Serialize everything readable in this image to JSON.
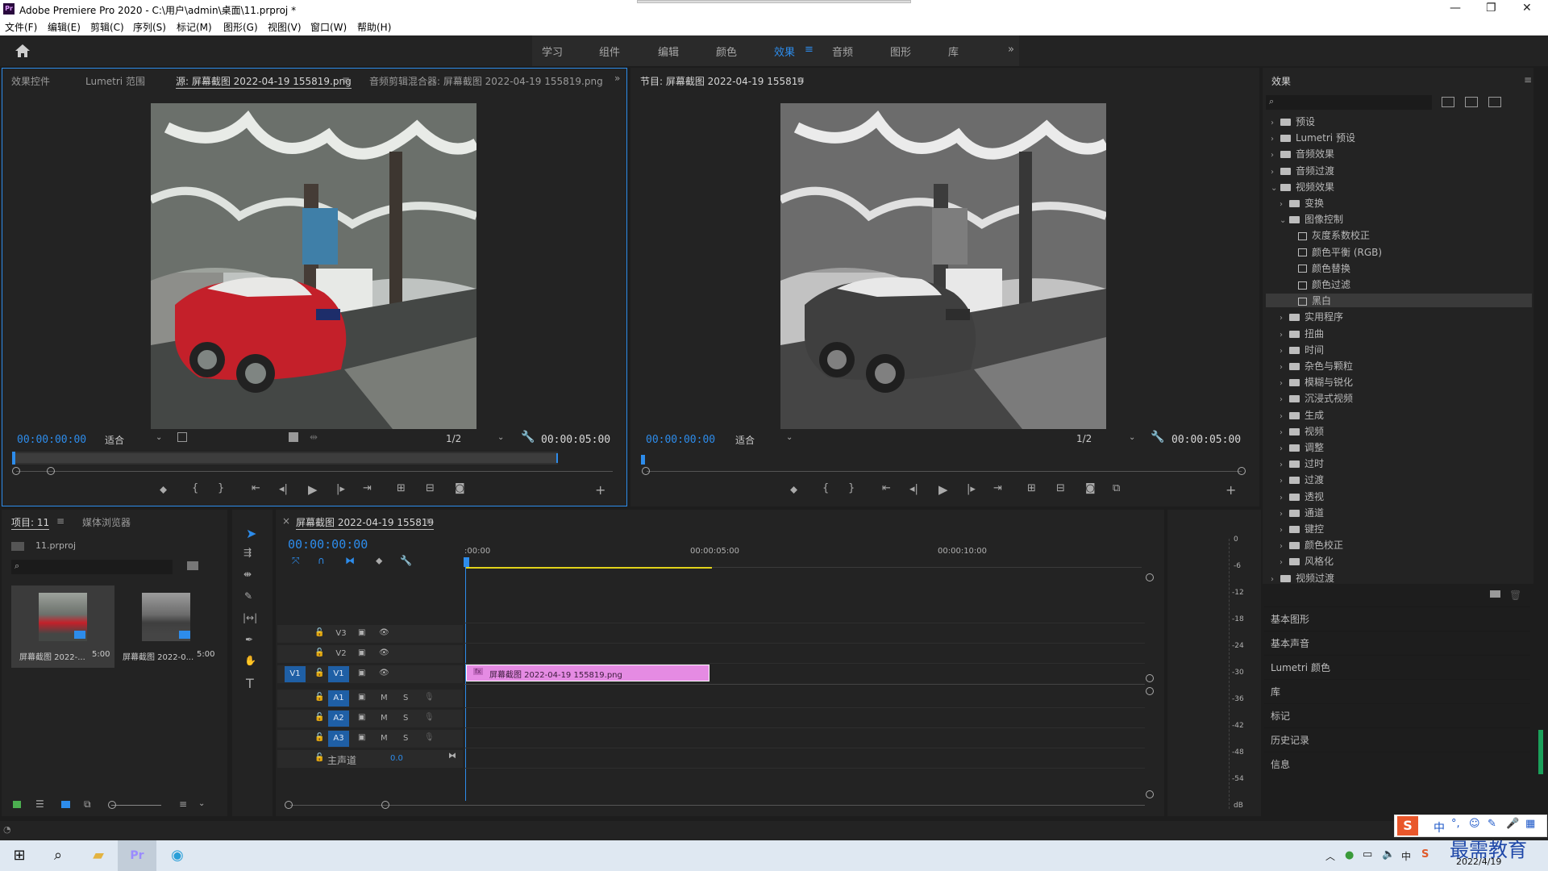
{
  "window": {
    "title": "Adobe Premiere Pro 2020 - C:\\用户\\admin\\桌面\\11.prproj *",
    "app_badge": "Pr",
    "min": "—",
    "max": "❐",
    "close": "✕"
  },
  "menu": [
    "文件(F)",
    "编辑(E)",
    "剪辑(C)",
    "序列(S)",
    "标记(M)",
    "图形(G)",
    "视图(V)",
    "窗口(W)",
    "帮助(H)"
  ],
  "workspaces": {
    "tabs": [
      "学习",
      "组件",
      "编辑",
      "颜色",
      "效果",
      "音频",
      "图形",
      "库"
    ],
    "active": "效果",
    "more": "»"
  },
  "source_panel": {
    "tabs": [
      "效果控件",
      "Lumetri 范围",
      "源: 屏幕截图 2022-04-19 155819.png",
      "音频剪辑混合器: 屏幕截图 2022-04-19 155819.png"
    ],
    "timecode": "00:00:00:00",
    "fit": "适合",
    "resolution": "1/2",
    "duration": "00:00:05:00"
  },
  "program_panel": {
    "title": "节目: 屏幕截图 2022-04-19 155819",
    "timecode": "00:00:00:00",
    "fit": "适合",
    "resolution": "1/2",
    "duration": "00:00:05:00"
  },
  "project_panel": {
    "tabs": [
      "项目: 11",
      "媒体浏览器"
    ],
    "project_file": "11.prproj",
    "items": [
      {
        "name": "屏幕截图 2022-...",
        "duration": "5:00"
      },
      {
        "name": "屏幕截图 2022-0...",
        "duration": "5:00"
      }
    ]
  },
  "timeline": {
    "tab": "屏幕截图 2022-04-19 155819",
    "timecode": "00:00:00:00",
    "ruler": [
      ":00:00",
      "00:00:05:00",
      "00:00:10:00"
    ],
    "video_tracks": [
      "V3",
      "V2",
      "V1"
    ],
    "audio_tracks": [
      "A1",
      "A2",
      "A3"
    ],
    "src_v": "V1",
    "master": "主声道",
    "master_val": "0.0",
    "clip": "屏幕截图 2022-04-19 155819.png",
    "m": "M",
    "s": "S",
    "fx": "fx"
  },
  "meter": {
    "labels": [
      "0",
      "-6",
      "-12",
      "-18",
      "-24",
      "-30",
      "-36",
      "-42",
      "-48",
      "-54",
      "dB"
    ]
  },
  "effects": {
    "title": "效果",
    "tree": [
      {
        "label": "预设",
        "level": 0,
        "type": "folder",
        "arrow": "›"
      },
      {
        "label": "Lumetri 预设",
        "level": 0,
        "type": "folder",
        "arrow": "›"
      },
      {
        "label": "音频效果",
        "level": 0,
        "type": "folder",
        "arrow": "›"
      },
      {
        "label": "音频过渡",
        "level": 0,
        "type": "folder",
        "arrow": "›"
      },
      {
        "label": "视频效果",
        "level": 0,
        "type": "folder",
        "arrow": "⌄"
      },
      {
        "label": "变换",
        "level": 1,
        "type": "folder",
        "arrow": "›"
      },
      {
        "label": "图像控制",
        "level": 1,
        "type": "folder",
        "arrow": "⌄"
      },
      {
        "label": "灰度系数校正",
        "level": 2,
        "type": "fx",
        "arrow": ""
      },
      {
        "label": "颜色平衡 (RGB)",
        "level": 2,
        "type": "fx",
        "arrow": ""
      },
      {
        "label": "颜色替换",
        "level": 2,
        "type": "fx",
        "arrow": ""
      },
      {
        "label": "颜色过滤",
        "level": 2,
        "type": "fx",
        "arrow": ""
      },
      {
        "label": "黑白",
        "level": 2,
        "type": "fx",
        "arrow": "",
        "selected": true
      },
      {
        "label": "实用程序",
        "level": 1,
        "type": "folder",
        "arrow": "›"
      },
      {
        "label": "扭曲",
        "level": 1,
        "type": "folder",
        "arrow": "›"
      },
      {
        "label": "时间",
        "level": 1,
        "type": "folder",
        "arrow": "›"
      },
      {
        "label": "杂色与颗粒",
        "level": 1,
        "type": "folder",
        "arrow": "›"
      },
      {
        "label": "模糊与锐化",
        "level": 1,
        "type": "folder",
        "arrow": "›"
      },
      {
        "label": "沉浸式视频",
        "level": 1,
        "type": "folder",
        "arrow": "›"
      },
      {
        "label": "生成",
        "level": 1,
        "type": "folder",
        "arrow": "›"
      },
      {
        "label": "视频",
        "level": 1,
        "type": "folder",
        "arrow": "›"
      },
      {
        "label": "调整",
        "level": 1,
        "type": "folder",
        "arrow": "›"
      },
      {
        "label": "过时",
        "level": 1,
        "type": "folder",
        "arrow": "›"
      },
      {
        "label": "过渡",
        "level": 1,
        "type": "folder",
        "arrow": "›"
      },
      {
        "label": "透视",
        "level": 1,
        "type": "folder",
        "arrow": "›"
      },
      {
        "label": "通道",
        "level": 1,
        "type": "folder",
        "arrow": "›"
      },
      {
        "label": "键控",
        "level": 1,
        "type": "folder",
        "arrow": "›"
      },
      {
        "label": "颜色校正",
        "level": 1,
        "type": "folder",
        "arrow": "›"
      },
      {
        "label": "风格化",
        "level": 1,
        "type": "folder",
        "arrow": "›"
      },
      {
        "label": "视频过渡",
        "level": 0,
        "type": "folder",
        "arrow": "›"
      }
    ]
  },
  "side_panels": [
    "基本图形",
    "基本声音",
    "Lumetri 颜色",
    "库",
    "标记",
    "历史记录",
    "信息"
  ],
  "taskbar": {
    "date": "2022/4/19",
    "ime": "中",
    "watermark": "最需教育",
    "pr": "Pr",
    "chevron": "︿",
    "ime2": "S"
  },
  "colors": {
    "accent": "#2d8ceb",
    "clip": "#e58be3",
    "work_area": "#e0d21a"
  }
}
